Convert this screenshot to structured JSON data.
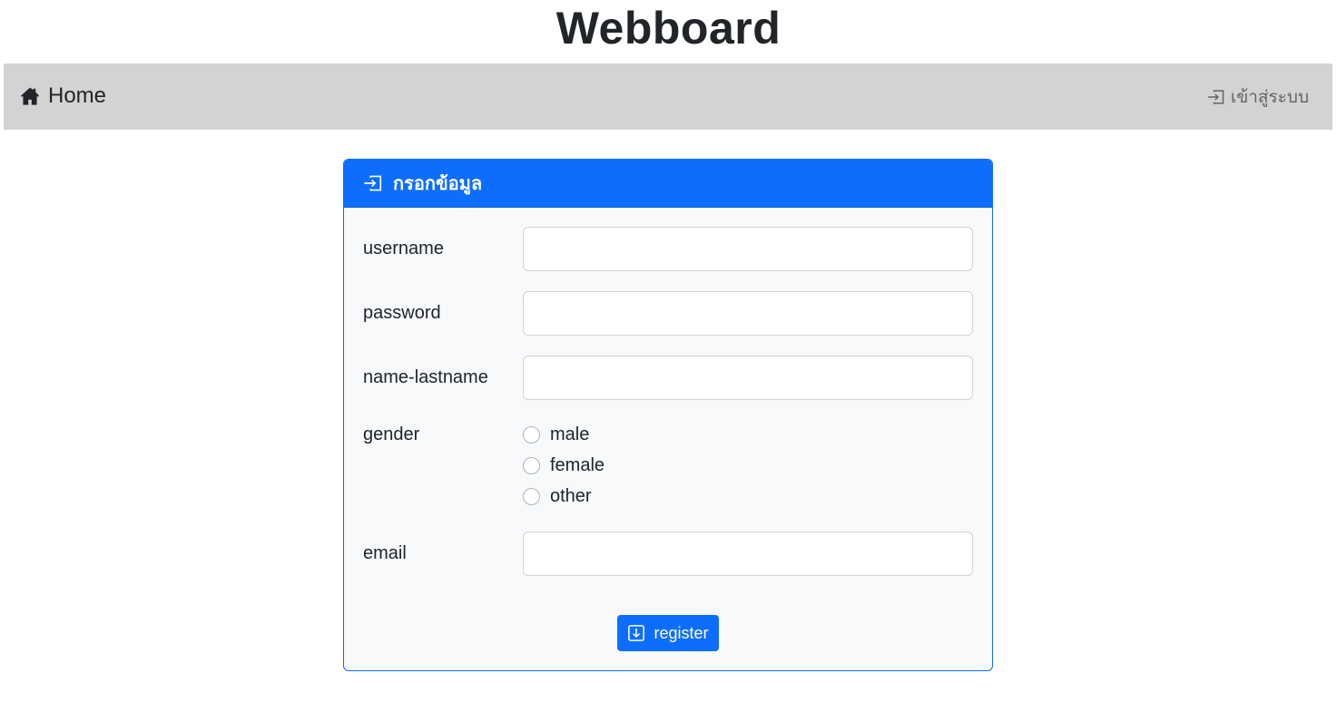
{
  "site": {
    "title": "Webboard"
  },
  "navbar": {
    "home": {
      "label": "Home",
      "icon": "house-icon"
    },
    "login": {
      "label": "เข้าสู่ระบบ",
      "icon": "box-arrow-in-right-icon"
    }
  },
  "card": {
    "header": {
      "title": "กรอกข้อมูล",
      "icon": "box-arrow-in-right-icon"
    },
    "accent_color": "#0d6efd",
    "fields": {
      "username": {
        "label": "username",
        "value": ""
      },
      "password": {
        "label": "password",
        "value": ""
      },
      "name_lastname": {
        "label": "name-lastname",
        "value": ""
      },
      "email": {
        "label": "email",
        "value": ""
      }
    },
    "gender": {
      "label": "gender",
      "options": [
        "male",
        "female",
        "other"
      ],
      "selected": null
    },
    "register_button": {
      "label": "register",
      "icon": "box-arrow-in-down-icon"
    }
  }
}
